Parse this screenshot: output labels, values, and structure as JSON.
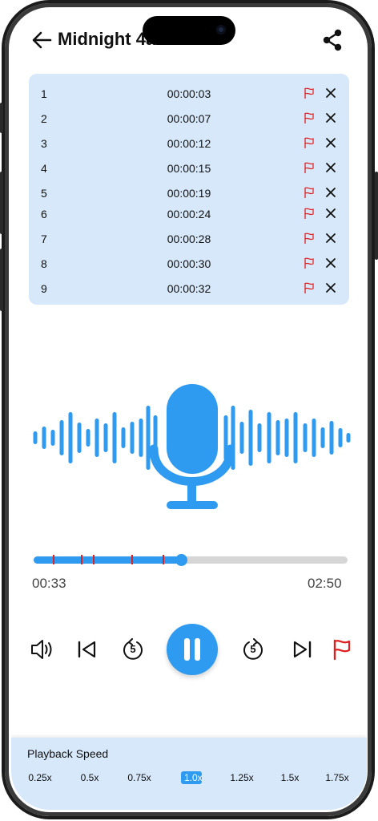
{
  "header": {
    "title": "Midnight            4a",
    "back_icon": "arrow-left-icon",
    "share_icon": "share-icon"
  },
  "marks": [
    {
      "index": "1",
      "time": "00:00:03"
    },
    {
      "index": "2",
      "time": "00:00:07"
    },
    {
      "index": "3",
      "time": "00:00:12"
    },
    {
      "index": "4",
      "time": "00:00:15"
    },
    {
      "index": "5",
      "time": "00:00:19"
    },
    {
      "index": "6",
      "time": "00:00:24"
    },
    {
      "index": "7",
      "time": "00:00:28"
    },
    {
      "index": "8",
      "time": "00:00:30"
    },
    {
      "index": "9",
      "time": "00:00:32"
    }
  ],
  "player": {
    "current_time": "00:33",
    "total_time": "02:50",
    "progress_fraction": 0.47,
    "marker_fractions": [
      0.06,
      0.15,
      0.19,
      0.31,
      0.41
    ]
  },
  "controls": {
    "volume_icon": "speaker-icon",
    "previous_icon": "skip-previous-icon",
    "rewind_icon": "rewind-5-icon",
    "rewind_label": "5",
    "pause_icon": "pause-icon",
    "forward_icon": "forward-5-icon",
    "forward_label": "5",
    "next_icon": "skip-next-icon",
    "flag_icon": "flag-icon"
  },
  "speed": {
    "title": "Playback Speed",
    "options": [
      "0.25x",
      "0.5x",
      "0.75x",
      "1.0x",
      "1.25x",
      "1.5x",
      "1.75x"
    ],
    "selected": "1.0x"
  },
  "colors": {
    "accent": "#2e9bf0",
    "panel": "#d6e8fa",
    "flag": "#e02020"
  }
}
